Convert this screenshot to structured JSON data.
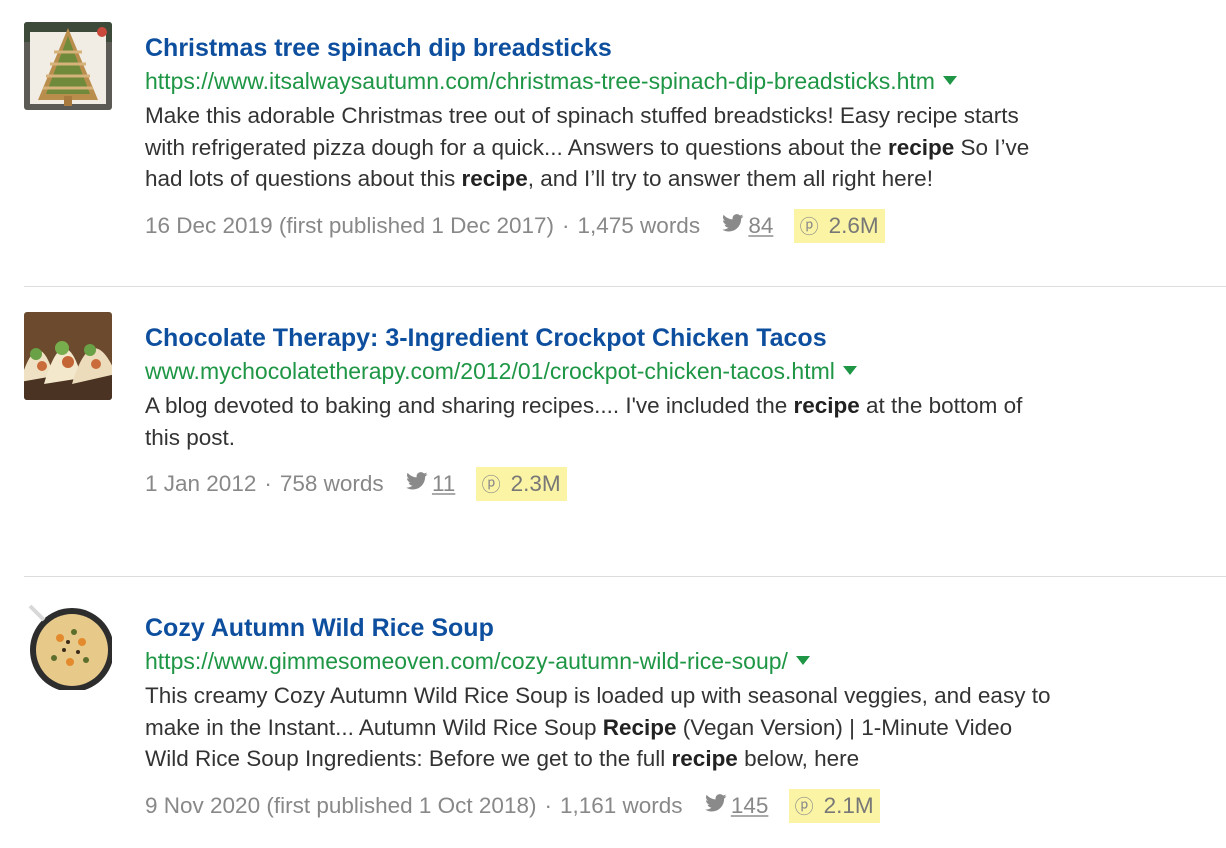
{
  "results": [
    {
      "title": "Christmas tree spinach dip breadsticks",
      "url": "https://www.itsalwaysautumn.com/christmas-tree-spinach-dip-breadsticks.htm",
      "snippet_lines": [
        [
          {
            "t": "Make this adorable Christmas tree out of spinach stuffed breadsticks! Easy recipe starts",
            "b": false
          }
        ],
        [
          {
            "t": "with refrigerated pizza dough for a quick... Answers to questions about the ",
            "b": false
          },
          {
            "t": "recipe",
            "b": true
          },
          {
            "t": " So I’ve",
            "b": false
          }
        ],
        [
          {
            "t": "had lots of questions about this ",
            "b": false
          },
          {
            "t": "recipe",
            "b": true
          },
          {
            "t": ", and I’ll try to answer them all right here!",
            "b": false
          }
        ]
      ],
      "date": "16 Dec 2019 (first published 1 Dec 2017)",
      "words": "1,475 words",
      "twitter": "84",
      "pinterest": "2.6M",
      "thumb_icon": "christmas-tree-breadsticks-thumbnail"
    },
    {
      "title": "Chocolate Therapy: 3-Ingredient Crockpot Chicken Tacos",
      "url": "www.mychocolatetherapy.com/2012/01/crockpot-chicken-tacos.html",
      "snippet_lines": [
        [
          {
            "t": "A blog devoted to baking and sharing recipes.... I've included the ",
            "b": false
          },
          {
            "t": "recipe",
            "b": true
          },
          {
            "t": " at the bottom of",
            "b": false
          }
        ],
        [
          {
            "t": "this post.",
            "b": false
          }
        ]
      ],
      "date": "1 Jan 2012",
      "words": "758 words",
      "twitter": "11",
      "pinterest": "2.3M",
      "thumb_icon": "chicken-tacos-thumbnail"
    },
    {
      "title": "Cozy Autumn Wild Rice Soup",
      "url": "https://www.gimmesomeoven.com/cozy-autumn-wild-rice-soup/",
      "snippet_lines": [
        [
          {
            "t": "This creamy Cozy Autumn Wild Rice Soup is loaded up with seasonal veggies, and easy to",
            "b": false
          }
        ],
        [
          {
            "t": "make in the Instant... Autumn Wild Rice Soup ",
            "b": false
          },
          {
            "t": "Recipe",
            "b": true
          },
          {
            "t": " (Vegan Version) | 1-Minute Video",
            "b": false
          }
        ],
        [
          {
            "t": "Wild Rice Soup Ingredients: Before we get to the full ",
            "b": false
          },
          {
            "t": "recipe",
            "b": true
          },
          {
            "t": " below, here",
            "b": false
          }
        ]
      ],
      "date": "9 Nov 2020 (first published 1 Oct 2018)",
      "words": "1,161 words",
      "twitter": "145",
      "pinterest": "2.1M",
      "thumb_icon": "wild-rice-soup-thumbnail"
    }
  ],
  "separator": "·",
  "colors": {
    "title": "#0d4f9e",
    "url": "#1e9645",
    "meta": "#888888",
    "pinterest_highlight": "#fbf4a5",
    "divider": "#dddddd"
  },
  "icons": {
    "twitter": "twitter-bird-icon",
    "pinterest": "pinterest-p-icon",
    "url_menu": "caret-down-icon"
  }
}
